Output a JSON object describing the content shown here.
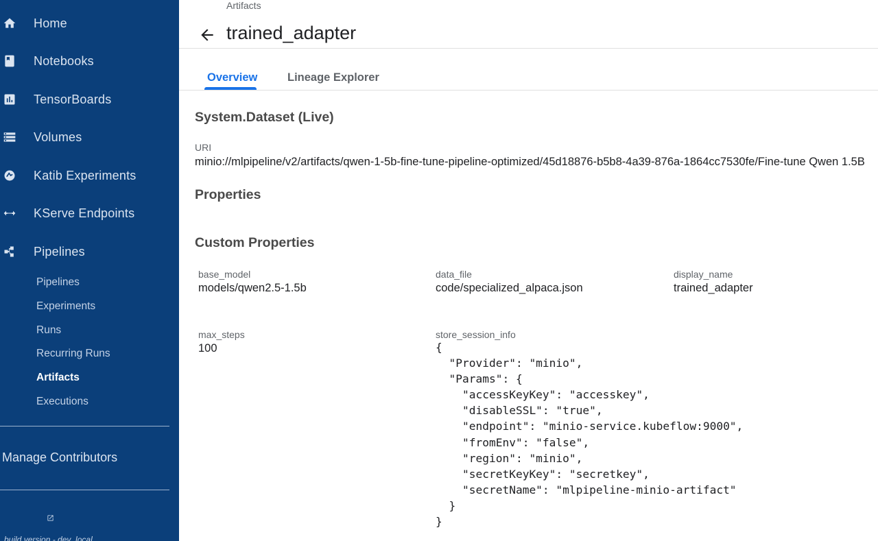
{
  "sidebar": {
    "items": [
      {
        "label": "Home",
        "icon": "home-icon"
      },
      {
        "label": "Notebooks",
        "icon": "notebook-icon"
      },
      {
        "label": "TensorBoards",
        "icon": "bar-chart-icon"
      },
      {
        "label": "Volumes",
        "icon": "storage-icon"
      },
      {
        "label": "Katib Experiments",
        "icon": "experiment-icon"
      },
      {
        "label": "KServe Endpoints",
        "icon": "endpoint-arrows-icon"
      },
      {
        "label": "Pipelines",
        "icon": "pipeline-icon"
      }
    ],
    "subitems": [
      {
        "label": "Pipelines"
      },
      {
        "label": "Experiments"
      },
      {
        "label": "Runs"
      },
      {
        "label": "Recurring Runs"
      },
      {
        "label": "Artifacts",
        "active": true
      },
      {
        "label": "Executions"
      }
    ],
    "manage_contributors": "Manage Contributors",
    "build_version": "build version - dev_local"
  },
  "header": {
    "breadcrumb": "Artifacts",
    "title": "trained_adapter"
  },
  "tabs": [
    {
      "label": "Overview",
      "active": true
    },
    {
      "label": "Lineage Explorer",
      "active": false
    }
  ],
  "overview": {
    "type_title": "System.Dataset (Live)",
    "uri_label": "URI",
    "uri_value": "minio://mlpipeline/v2/artifacts/qwen-1-5b-fine-tune-pipeline-optimized/45d18876-b5b8-4a39-876a-1864cc7530fe/Fine-tune Qwen 1.5B",
    "properties_title": "Properties",
    "custom_properties_title": "Custom Properties",
    "fields": {
      "base_model": {
        "label": "base_model",
        "value": "models/qwen2.5-1.5b"
      },
      "data_file": {
        "label": "data_file",
        "value": "code/specialized_alpaca.json"
      },
      "display_name": {
        "label": "display_name",
        "value": "trained_adapter"
      },
      "max_steps": {
        "label": "max_steps",
        "value": "100"
      },
      "store_session_info": {
        "label": "store_session_info",
        "value": "{\n  \"Provider\": \"minio\",\n  \"Params\": {\n    \"accessKeyKey\": \"accesskey\",\n    \"disableSSL\": \"true\",\n    \"endpoint\": \"minio-service.kubeflow:9000\",\n    \"fromEnv\": \"false\",\n    \"region\": \"minio\",\n    \"secretKeyKey\": \"secretkey\",\n    \"secretName\": \"mlpipeline-minio-artifact\"\n  }\n}"
      }
    }
  },
  "colors": {
    "sidebar_bg": "#0b3f7a",
    "accent": "#1a73e8"
  }
}
